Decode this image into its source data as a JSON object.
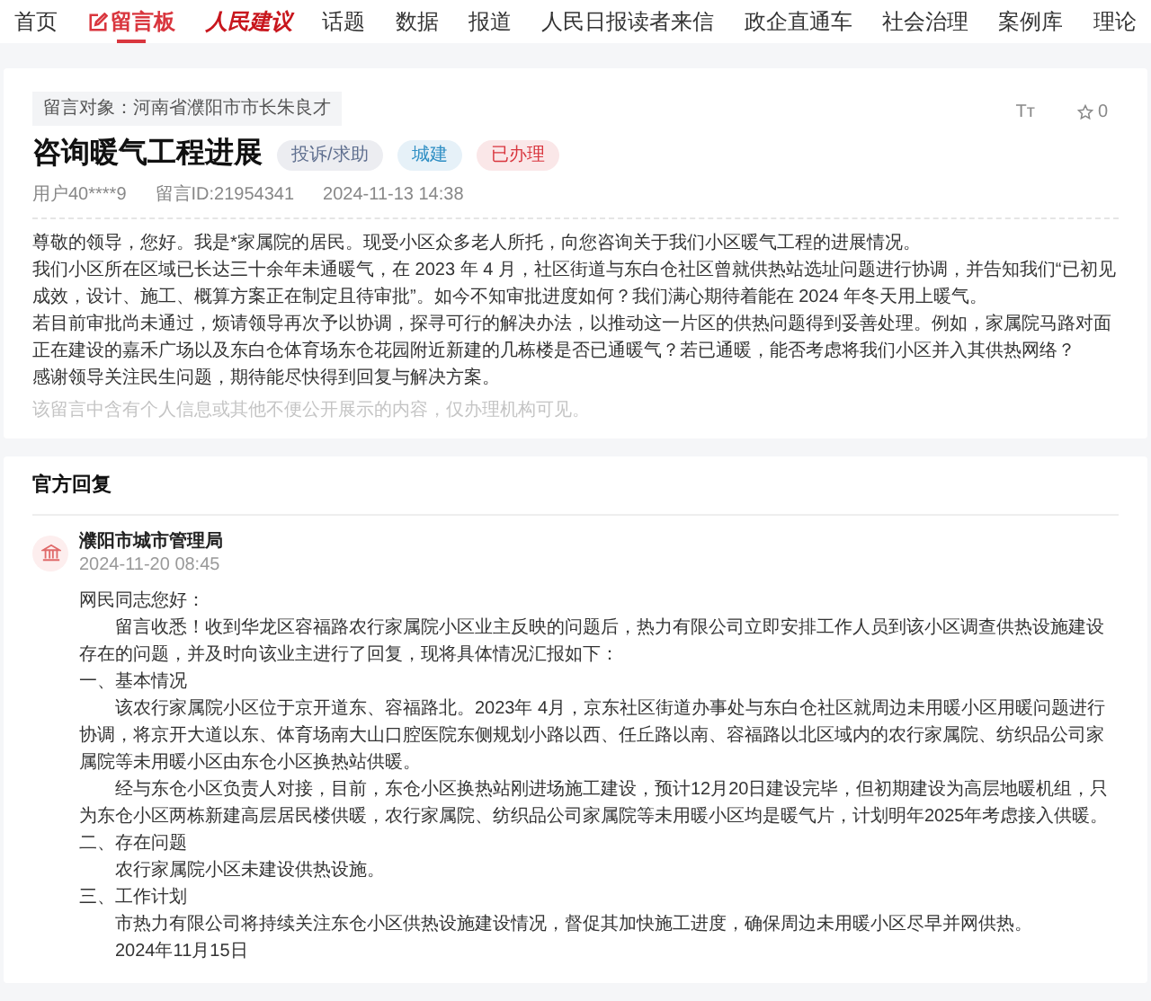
{
  "nav": [
    {
      "label": "首页",
      "kind": "text",
      "selected": false
    },
    {
      "label": "留言板",
      "kind": "board",
      "selected": true
    },
    {
      "label": "人民建议",
      "kind": "script",
      "selected": false
    },
    {
      "label": "话题",
      "kind": "text",
      "selected": false
    },
    {
      "label": "数据",
      "kind": "text",
      "selected": false
    },
    {
      "label": "报道",
      "kind": "text",
      "selected": false
    },
    {
      "label": "人民日报读者来信",
      "kind": "text",
      "selected": false
    },
    {
      "label": "政企直通车",
      "kind": "text",
      "selected": false
    },
    {
      "label": "社会治理",
      "kind": "text",
      "selected": false
    },
    {
      "label": "案例库",
      "kind": "text",
      "selected": false
    },
    {
      "label": "理论",
      "kind": "text",
      "selected": false
    }
  ],
  "message": {
    "target": "留言对象：河南省濮阳市市长朱良才",
    "font_size_label": "Tт",
    "favorites": "0",
    "title": "咨询暖气工程进展",
    "tags": [
      {
        "label": "投诉/求助",
        "color": "#5f6f8f"
      },
      {
        "label": "城建",
        "color": "#2f8fc4"
      },
      {
        "label": "已办理",
        "color": "#d9363e"
      }
    ],
    "meta": [
      "用户40****9",
      "留言ID:21954341",
      "2024-11-13 14:38"
    ],
    "paragraphs": [
      "尊敬的领导，您好。我是*家属院的居民。现受小区众多老人所托，向您咨询关于我们小区暖气工程的进展情况。",
      "我们小区所在区域已长达三十余年未通暖气，在 2023 年 4 月，社区街道与东白仓社区曾就供热站选址问题进行协调，并告知我们“已初见成效，设计、施工、概算方案正在制定且待审批”。如今不知审批进度如何？我们满心期待着能在 2024 年冬天用上暖气。",
      "若目前审批尚未通过，烦请领导再次予以协调，探寻可行的解决办法，以推动这一片区的供热问题得到妥善处理。例如，家属院马路对面正在建设的嘉禾广场以及东白仓体育场东仓花园附近新建的几栋楼是否已通暖气？若已通暖，能否考虑将我们小区并入其供热网络？",
      "感谢领导关注民生问题，期待能尽快得到回复与解决方案。"
    ],
    "privacy_note": "该留言中含有个人信息或其他不便公开展示的内容，仅办理机构可见。"
  },
  "reply": {
    "heading": "官方回复",
    "org": "濮阳市城市管理局",
    "time": "2024-11-20 08:45",
    "lines": [
      {
        "kind": "greeting",
        "text": "网民同志您好："
      },
      {
        "kind": "para",
        "text": "留言收悉！收到华龙区容福路农行家属院小区业主反映的问题后，热力有限公司立即安排工作人员到该小区调查供热设施建设存在的问题，并及时向该业主进行了回复，现将具体情况汇报如下："
      },
      {
        "kind": "heading",
        "text": "一、基本情况"
      },
      {
        "kind": "para",
        "text": "该农行家属院小区位于京开道东、容福路北。2023年 4月，京东社区街道办事处与东白仓社区就周边未用暖小区用暖问题进行协调，将京开大道以东、体育场南大山口腔医院东侧规划小路以西、任丘路以南、容福路以北区域内的农行家属院、纺织品公司家属院等未用暖小区由东仓小区换热站供暖。"
      },
      {
        "kind": "para",
        "text": "经与东仓小区负责人对接，目前，东仓小区换热站刚进场施工建设，预计12月20日建设完毕，但初期建设为高层地暖机组，只为东仓小区两栋新建高层居民楼供暖，农行家属院、纺织品公司家属院等未用暖小区均是暖气片，计划明年2025年考虑接入供暖。"
      },
      {
        "kind": "heading",
        "text": "二、存在问题"
      },
      {
        "kind": "para",
        "text": "农行家属院小区未建设供热设施。"
      },
      {
        "kind": "heading",
        "text": "三、工作计划"
      },
      {
        "kind": "para",
        "text": "市热力有限公司将持续关注东仓小区供热设施建设情况，督促其加快施工进度，确保周边未用暖小区尽早并网供热。"
      },
      {
        "kind": "date",
        "text": "2024年11月15日"
      }
    ]
  }
}
